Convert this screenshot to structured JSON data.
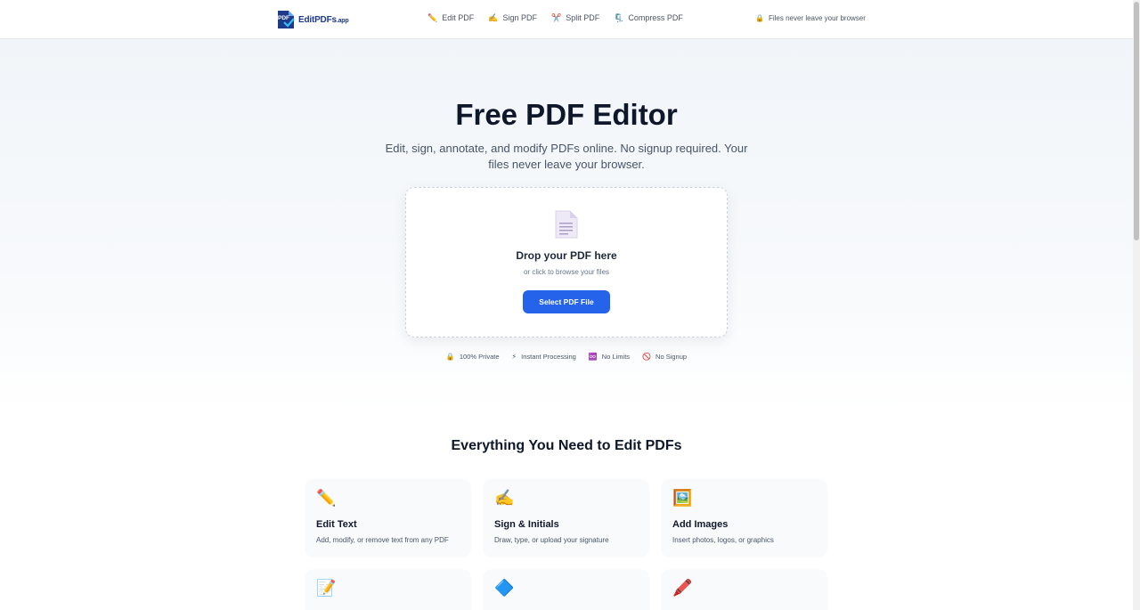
{
  "header": {
    "logo": {
      "badge": "PDF",
      "name": "EditPDFs",
      "tld": ".app"
    },
    "nav": [
      {
        "icon": "pencil-icon",
        "glyph": "✏️",
        "label": "Edit PDF"
      },
      {
        "icon": "writing-hand-icon",
        "glyph": "✍️",
        "label": "Sign PDF"
      },
      {
        "icon": "scissors-icon",
        "glyph": "✂️",
        "label": "Split PDF"
      },
      {
        "icon": "clamp-icon",
        "glyph": "🗜️",
        "label": "Compress PDF"
      }
    ],
    "privacy_note": {
      "glyph": "🔒",
      "text": "Files never leave your browser"
    }
  },
  "hero": {
    "title": "Free PDF Editor",
    "subtitle": "Edit, sign, annotate, and modify PDFs online. No signup required. Your files never leave your browser.",
    "dropzone": {
      "title": "Drop your PDF here",
      "subtitle": "or click to browse your files",
      "button_label": "Select PDF File"
    },
    "badges": [
      {
        "icon": "lock-icon",
        "glyph": "🔒",
        "label": "100% Private"
      },
      {
        "icon": "lightning-icon",
        "glyph": "⚡",
        "label": "Instant Processing"
      },
      {
        "icon": "infinity-icon",
        "glyph": "♾️",
        "label": "No Limits"
      },
      {
        "icon": "prohibited-icon",
        "glyph": "🚫",
        "label": "No Signup"
      }
    ]
  },
  "features": {
    "title": "Everything You Need to Edit PDFs",
    "cards": [
      {
        "icon": "pencil-icon",
        "glyph": "✏️",
        "title": "Edit Text",
        "desc": "Add, modify, or remove text from any PDF"
      },
      {
        "icon": "writing-hand-icon",
        "glyph": "✍️",
        "title": "Sign & Initials",
        "desc": "Draw, type, or upload your signature"
      },
      {
        "icon": "framed-picture-icon",
        "glyph": "🖼️",
        "title": "Add Images",
        "desc": "Insert photos, logos, or graphics"
      },
      {
        "icon": "memo-icon",
        "glyph": "📝",
        "title": "",
        "desc": ""
      },
      {
        "icon": "blue-diamond-icon",
        "glyph": "🔷",
        "title": "",
        "desc": ""
      },
      {
        "icon": "highlighter-icon",
        "glyph": "🖍️",
        "title": "",
        "desc": ""
      }
    ]
  },
  "colors": {
    "accent": "#2563eb",
    "heading": "#0f172a",
    "muted": "#475569",
    "logo": "#1e3a8a"
  }
}
